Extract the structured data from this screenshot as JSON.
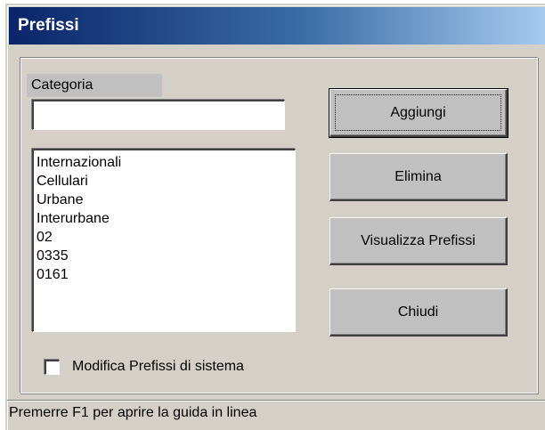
{
  "window": {
    "title": "Prefissi"
  },
  "form": {
    "category_label": "Categoria",
    "category_value": "",
    "prefix_list": [
      "Internazionali",
      "Cellulari",
      "Urbane",
      "Interurbane",
      "02",
      "0335",
      "0161"
    ],
    "system_checkbox_label": "Modifica Prefissi di sistema",
    "system_checkbox_checked": false
  },
  "buttons": {
    "add": "Aggiungi",
    "delete": "Elimina",
    "view": "Visualizza Prefissi",
    "close": "Chiudi"
  },
  "statusbar": {
    "text": "Premerre F1 per aprire la guida in linea"
  },
  "colors": {
    "face": "#d4d0c8",
    "title_gradient_start": "#0a246a",
    "title_gradient_end": "#a6caf0"
  }
}
